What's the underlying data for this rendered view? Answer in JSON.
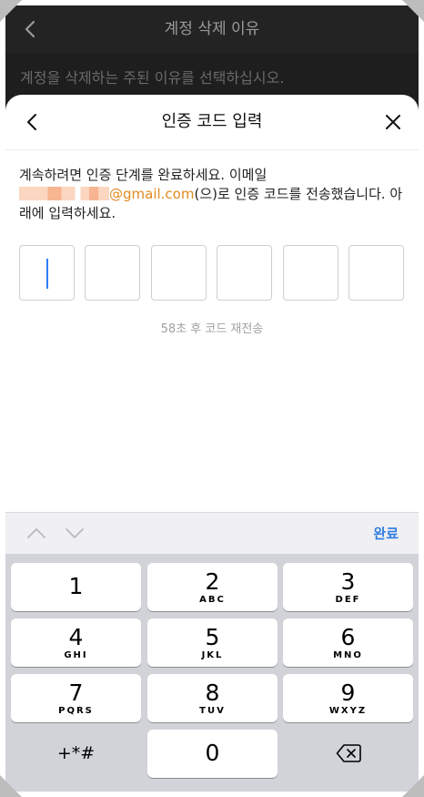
{
  "background_page": {
    "title": "계정 삭제 이유",
    "instruction": "계정을 삭제하는 주된 이유를 선택하십시오."
  },
  "sheet": {
    "title": "인증 코드 입력",
    "description_before": "계속하려면 인증 단계를 완료하세요. 이메일",
    "email_suffix": "@gmail.com",
    "description_after": "(으)로 인증 코드를 전송했습니다. 아래에 입력하세요.",
    "code_length": 6,
    "resend_text": "58초 후 코드 재전송"
  },
  "accessory": {
    "done_label": "완료"
  },
  "keypad": {
    "keys": [
      {
        "digit": "1",
        "letters": ""
      },
      {
        "digit": "2",
        "letters": "ABC"
      },
      {
        "digit": "3",
        "letters": "DEF"
      },
      {
        "digit": "4",
        "letters": "GHI"
      },
      {
        "digit": "5",
        "letters": "JKL"
      },
      {
        "digit": "6",
        "letters": "MNO"
      },
      {
        "digit": "7",
        "letters": "PQRS"
      },
      {
        "digit": "8",
        "letters": "TUV"
      },
      {
        "digit": "9",
        "letters": "WXYZ"
      }
    ],
    "symbols_label": "+*#",
    "zero": "0"
  },
  "icons": {
    "back": "chevron-left-icon",
    "close": "close-icon",
    "up": "chevron-up-icon",
    "down": "chevron-down-icon",
    "delete": "backspace-icon"
  },
  "colors": {
    "accent": "#2f7de1",
    "email": "#e08a1e",
    "caret": "#2d7ef7"
  }
}
